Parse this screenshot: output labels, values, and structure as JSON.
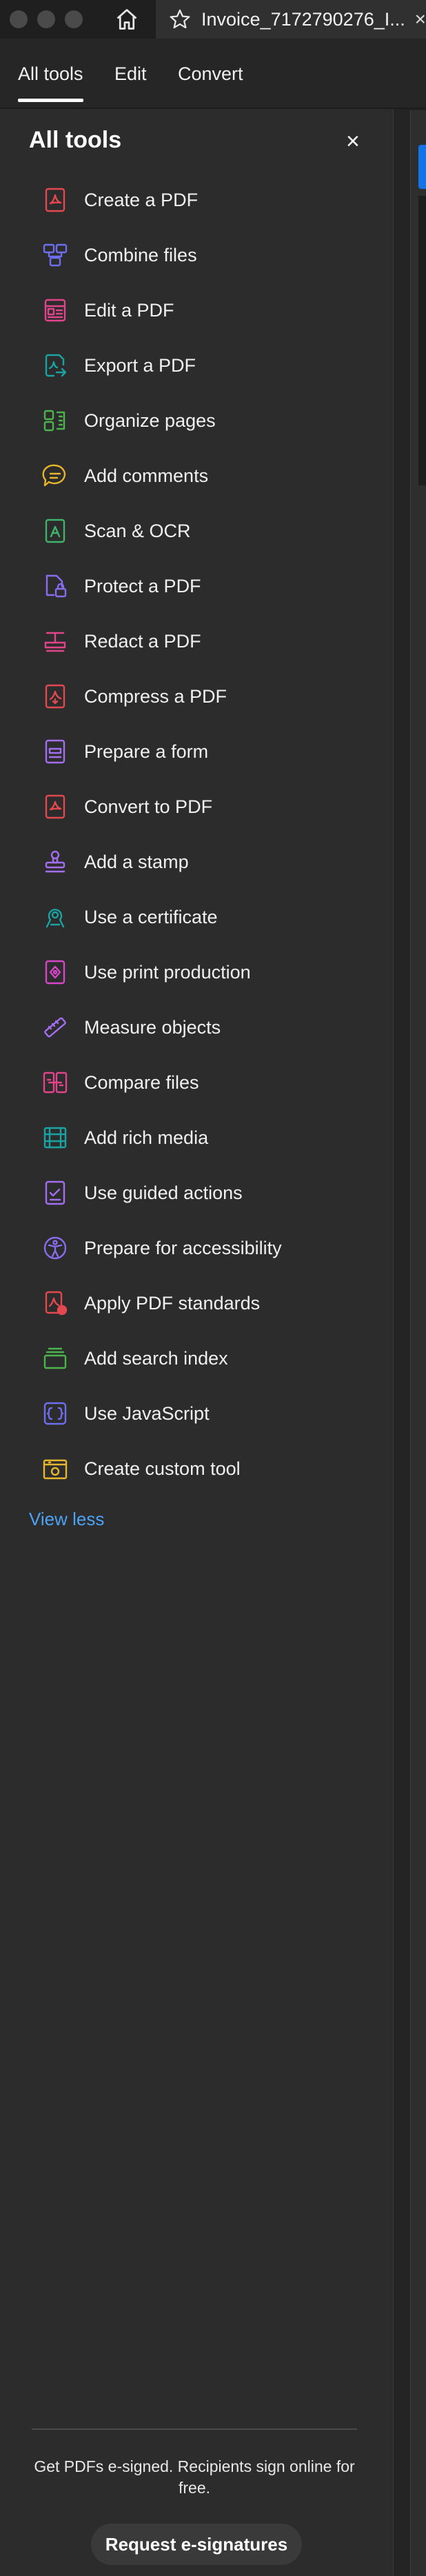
{
  "titlebar": {
    "tab_title": "Invoice_7172790276_I...",
    "tab_close": "×"
  },
  "menu": {
    "all_tools": "All tools",
    "edit": "Edit",
    "convert": "Convert"
  },
  "panel": {
    "title": "All tools",
    "close": "×",
    "tools": [
      {
        "label": "Create a PDF",
        "icon": "create-pdf-icon",
        "color": "#e34850"
      },
      {
        "label": "Combine files",
        "icon": "combine-files-icon",
        "color": "#6e6ef0"
      },
      {
        "label": "Edit a PDF",
        "icon": "edit-pdf-icon",
        "color": "#e0458b"
      },
      {
        "label": "Export a PDF",
        "icon": "export-pdf-icon",
        "color": "#1aa3a3"
      },
      {
        "label": "Organize pages",
        "icon": "organize-pages-icon",
        "color": "#4db34d"
      },
      {
        "label": "Add comments",
        "icon": "comment-icon",
        "color": "#e8b62c"
      },
      {
        "label": "Scan & OCR",
        "icon": "scan-ocr-icon",
        "color": "#3fb36b"
      },
      {
        "label": "Protect a PDF",
        "icon": "protect-pdf-icon",
        "color": "#8a6cf0"
      },
      {
        "label": "Redact a PDF",
        "icon": "redact-pdf-icon",
        "color": "#e0458b"
      },
      {
        "label": "Compress a PDF",
        "icon": "compress-pdf-icon",
        "color": "#e34850"
      },
      {
        "label": "Prepare a form",
        "icon": "prepare-form-icon",
        "color": "#a36ef0"
      },
      {
        "label": "Convert to PDF",
        "icon": "convert-pdf-icon",
        "color": "#e34850"
      },
      {
        "label": "Add a stamp",
        "icon": "stamp-icon",
        "color": "#a36ef0"
      },
      {
        "label": "Use a certificate",
        "icon": "certificate-icon",
        "color": "#1aa3a3"
      },
      {
        "label": "Use print production",
        "icon": "print-production-icon",
        "color": "#d846c8"
      },
      {
        "label": "Measure objects",
        "icon": "measure-icon",
        "color": "#a36ef0"
      },
      {
        "label": "Compare files",
        "icon": "compare-files-icon",
        "color": "#e0458b"
      },
      {
        "label": "Add rich media",
        "icon": "rich-media-icon",
        "color": "#1aa3a3"
      },
      {
        "label": "Use guided actions",
        "icon": "guided-actions-icon",
        "color": "#a36ef0"
      },
      {
        "label": "Prepare for accessibility",
        "icon": "accessibility-icon",
        "color": "#8a6cf0"
      },
      {
        "label": "Apply PDF standards",
        "icon": "pdf-standards-icon",
        "color": "#e34850"
      },
      {
        "label": "Add search index",
        "icon": "search-index-icon",
        "color": "#4db34d"
      },
      {
        "label": "Use JavaScript",
        "icon": "javascript-icon",
        "color": "#6e6ef0"
      },
      {
        "label": "Create custom tool",
        "icon": "custom-tool-icon",
        "color": "#e8b62c"
      }
    ],
    "view_less": "View less",
    "promo_text": "Get PDFs e-signed. Recipients sign online for free.",
    "request_button": "Request e-signatures"
  }
}
